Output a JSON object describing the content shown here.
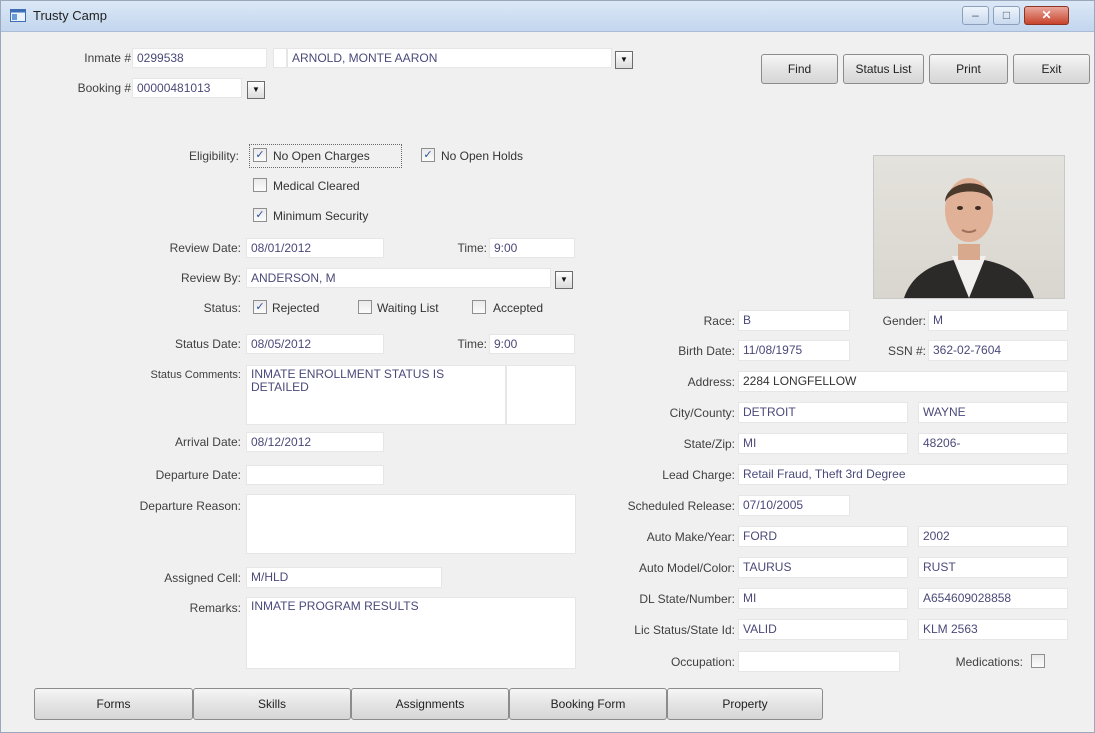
{
  "window": {
    "title": "Trusty Camp",
    "minimize_icon": "minimize-icon",
    "maximize_icon": "maximize-icon",
    "close_icon": "close-icon"
  },
  "header": {
    "inmate_label": "Inmate #",
    "inmate_number": "0299538",
    "inmate_name": "ARNOLD, MONTE AARON",
    "booking_label": "Booking #",
    "booking_number": "00000481013"
  },
  "toolbar": {
    "find": "Find",
    "status_list": "Status List",
    "print": "Print",
    "exit": "Exit"
  },
  "eligibility": {
    "label": "Eligibility:",
    "no_open_charges": {
      "label": "No Open Charges",
      "checked": true
    },
    "no_open_holds": {
      "label": "No Open Holds",
      "checked": true
    },
    "medical_cleared": {
      "label": "Medical Cleared",
      "checked": false
    },
    "minimum_security": {
      "label": "Minimum Security",
      "checked": true
    }
  },
  "review": {
    "date_label": "Review Date:",
    "date": "08/01/2012",
    "time_label": "Time:",
    "time": "9:00",
    "by_label": "Review By:",
    "by": "ANDERSON, M"
  },
  "status": {
    "label": "Status:",
    "rejected": {
      "label": "Rejected",
      "checked": true
    },
    "waiting_list": {
      "label": "Waiting List",
      "checked": false
    },
    "accepted": {
      "label": "Accepted",
      "checked": false
    },
    "date_label": "Status Date:",
    "date": "08/05/2012",
    "time_label": "Time:",
    "time": "9:00",
    "comments_label": "Status Comments:",
    "comments": "INMATE ENROLLMENT STATUS IS DETAILED"
  },
  "arrival": {
    "label": "Arrival Date:",
    "date": "08/12/2012"
  },
  "departure": {
    "date_label": "Departure Date:",
    "date": "",
    "reason_label": "Departure Reason:",
    "reason": ""
  },
  "cell": {
    "label": "Assigned Cell:",
    "value": "M/HLD"
  },
  "remarks": {
    "label": "Remarks:",
    "value": "INMATE PROGRAM RESULTS"
  },
  "person": {
    "race_label": "Race:",
    "race": "B",
    "gender_label": "Gender:",
    "gender": "M",
    "birth_label": "Birth Date:",
    "birth": "11/08/1975",
    "ssn_label": "SSN #:",
    "ssn": "362-02-7604",
    "address_label": "Address:",
    "address": "2284 LONGFELLOW",
    "city_label": "City/County:",
    "city": "DETROIT",
    "county": "WAYNE",
    "statezip_label": "State/Zip:",
    "state": "MI",
    "zip": "48206-",
    "lead_label": "Lead Charge:",
    "lead": "Retail Fraud, Theft 3rd Degree",
    "release_label": "Scheduled Release:",
    "release": "07/10/2005",
    "auto_make_label": "Auto Make/Year:",
    "auto_make": "FORD",
    "auto_year": "2002",
    "auto_model_label": "Auto Model/Color:",
    "auto_model": "TAURUS",
    "auto_color": "RUST",
    "dl_label": "DL State/Number:",
    "dl_state": "MI",
    "dl_number": "A654609028858",
    "lic_label": "Lic Status/State Id:",
    "lic_status": "VALID",
    "state_id": "KLM 2563",
    "occupation_label": "Occupation:",
    "occupation": "",
    "medications_label": "Medications:",
    "medications_checked": false
  },
  "bottom_tabs": [
    "Forms",
    "Skills",
    "Assignments",
    "Booking Form",
    "Property"
  ]
}
